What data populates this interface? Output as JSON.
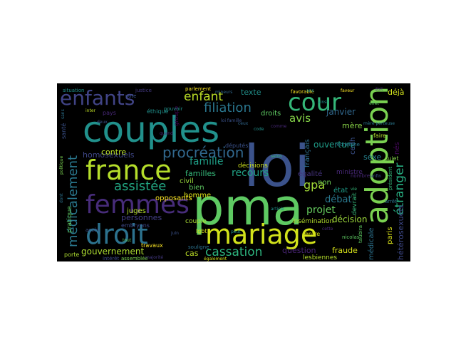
{
  "wordcloud": {
    "background": "#000000",
    "words": [
      {
        "text": "pma",
        "color": "#5ec962"
      },
      {
        "text": "loi",
        "color": "#3b528b"
      },
      {
        "text": "couples",
        "color": "#21918c"
      },
      {
        "text": "adoption",
        "color": "#7ad151"
      },
      {
        "text": "mariage",
        "color": "#d2e21b"
      },
      {
        "text": "droit",
        "color": "#2c728e"
      },
      {
        "text": "france",
        "color": "#b5de2b"
      },
      {
        "text": "femmes",
        "color": "#472c7a"
      },
      {
        "text": "enfants",
        "color": "#414487"
      },
      {
        "text": "cour",
        "color": "#35b779"
      },
      {
        "text": "procréation",
        "color": "#31688e"
      },
      {
        "text": "assistée",
        "color": "#22a884"
      },
      {
        "text": "médicalement",
        "color": "#2a788e"
      },
      {
        "text": "étranger",
        "color": "#27ad81"
      },
      {
        "text": "enfant",
        "color": "#bddf26"
      },
      {
        "text": "filiation",
        "color": "#2a768e"
      },
      {
        "text": "famille",
        "color": "#1fa088"
      },
      {
        "text": "cassation",
        "color": "#2db27d"
      },
      {
        "text": "gpa",
        "color": "#a2da37"
      },
      {
        "text": "avis",
        "color": "#86d549"
      },
      {
        "text": "familles",
        "color": "#35b779"
      },
      {
        "text": "recours",
        "color": "#20a386"
      },
      {
        "text": "homosexuels",
        "color": "#3f4788"
      },
      {
        "text": "gouvernement",
        "color": "#addc30"
      },
      {
        "text": "texte",
        "color": "#21918c"
      },
      {
        "text": "ouverture",
        "color": "#1f9e89"
      },
      {
        "text": "droits",
        "color": "#5ec962"
      },
      {
        "text": "janvier",
        "color": "#31688e"
      },
      {
        "text": "mère",
        "color": "#89d548"
      },
      {
        "text": "contre",
        "color": "#b8de29"
      },
      {
        "text": "civil",
        "color": "#9bd93c"
      },
      {
        "text": "bien",
        "color": "#5ec962"
      },
      {
        "text": "homme",
        "color": "#dde318"
      },
      {
        "text": "juges",
        "color": "#b5de2b"
      },
      {
        "text": "personnes",
        "color": "#433e85"
      },
      {
        "text": "projet",
        "color": "#65cb5e"
      },
      {
        "text": "débat",
        "color": "#2a788e"
      },
      {
        "text": "décision",
        "color": "#9dd93b"
      },
      {
        "text": "égalité",
        "color": "#46337f"
      },
      {
        "text": "français",
        "color": "#2e6f8e"
      },
      {
        "text": "état",
        "color": "#1e9c89"
      },
      {
        "text": "non",
        "color": "#70cf57"
      },
      {
        "text": "question",
        "color": "#482475"
      },
      {
        "text": "fraude",
        "color": "#d8e219"
      },
      {
        "text": "paris",
        "color": "#dae319"
      },
      {
        "text": "hétérosexuels",
        "color": "#3e4989"
      },
      {
        "text": "déjà",
        "color": "#d0e11c"
      },
      {
        "text": "sexe",
        "color": "#26828e"
      },
      {
        "text": "lesbiennes",
        "color": "#b5de2b"
      },
      {
        "text": "députés",
        "color": "#3b528b"
      },
      {
        "text": "opposants",
        "color": "#fde725"
      },
      {
        "text": "décisions",
        "color": "#cde11d"
      },
      {
        "text": "ministre",
        "color": "#482878"
      },
      {
        "text": "cas",
        "color": "#bddf26"
      },
      {
        "text": "insémination",
        "color": "#b2dd2d"
      },
      {
        "text": "devrait",
        "color": "#35b779"
      },
      {
        "text": "nés",
        "color": "#46085c"
      },
      {
        "text": "cedh",
        "color": "#3b528b"
      },
      {
        "text": "médicale",
        "color": "#2c728e"
      },
      {
        "text": "couple",
        "color": "#a8db34"
      },
      {
        "text": "lgbt",
        "color": "#d8e219"
      },
      {
        "text": "embryons",
        "color": "#3e4989"
      },
      {
        "text": "pratique",
        "color": "#5ec962"
      },
      {
        "text": "groupe",
        "color": "#440154"
      },
      {
        "text": "santé",
        "color": "#3b528b"
      },
      {
        "text": "entre",
        "color": "#dde318"
      },
      {
        "text": "travaux",
        "color": "#fde725"
      },
      {
        "text": "sujet",
        "color": "#84d44b"
      },
      {
        "text": "faire",
        "color": "#b5de2b"
      },
      {
        "text": "pays",
        "color": "#482878"
      },
      {
        "text": "intérêt",
        "color": "#3e4989"
      },
      {
        "text": "éthique",
        "color": "#21918c"
      },
      {
        "text": "président",
        "color": "#35b779"
      },
      {
        "text": "nombre",
        "color": "#482878"
      },
      {
        "text": "favorable",
        "color": "#fde725"
      },
      {
        "text": "taubira",
        "color": "#5ec962"
      },
      {
        "text": "arrêt",
        "color": "#2c728e"
      },
      {
        "text": "porte",
        "color": "#addc30"
      },
      {
        "text": "accès",
        "color": "#3b528b"
      },
      {
        "text": "assemblée",
        "color": "#7ad151"
      },
      {
        "text": "souligne",
        "color": "#2c728e"
      },
      {
        "text": "nicolas",
        "color": "#5ec962"
      },
      {
        "text": "recherche",
        "color": "#2a788e"
      },
      {
        "text": "pouvoir",
        "color": "#21918c"
      },
      {
        "text": "vote",
        "color": "#3b528b"
      },
      {
        "text": "situation",
        "color": "#21918c"
      },
      {
        "text": "parlement",
        "color": "#fde725"
      },
      {
        "text": "justice",
        "color": "#443983"
      },
      {
        "text": "inter",
        "color": "#c0df25"
      },
      {
        "text": "deux",
        "color": "#3b528b"
      },
      {
        "text": "mineurs",
        "color": "#31688e"
      },
      {
        "text": "comme",
        "color": "#482878"
      },
      {
        "text": "ans",
        "color": "#21918c"
      },
      {
        "text": "faveur",
        "color": "#fde725"
      },
      {
        "text": "effet",
        "color": "#5ec962"
      },
      {
        "text": "sans",
        "color": "#2c728e"
      },
      {
        "text": "enfin",
        "color": "#3b528b"
      },
      {
        "text": "ainsi",
        "color": "#21918c"
      },
      {
        "text": "selon",
        "color": "#35b779"
      },
      {
        "text": "quand",
        "color": "#482878"
      },
      {
        "text": "mère porteuse",
        "color": "#2a788e"
      },
      {
        "text": "politique",
        "color": "#7ad151"
      },
      {
        "text": "loi famille",
        "color": "#3b528b"
      },
      {
        "text": "également",
        "color": "#d8e219"
      },
      {
        "text": "majorité",
        "color": "#443983"
      },
      {
        "text": "article",
        "color": "#21918c"
      },
      {
        "text": "vie",
        "color": "#35b779"
      },
      {
        "text": "ceux",
        "color": "#31688e"
      },
      {
        "text": "doit",
        "color": "#482878"
      },
      {
        "text": "dont",
        "color": "#2c728e"
      },
      {
        "text": "peut",
        "color": "#21918c"
      },
      {
        "text": "tout",
        "color": "#5ec962"
      },
      {
        "text": "juin",
        "color": "#3b528b"
      },
      {
        "text": "code",
        "color": "#21918c"
      },
      {
        "text": "cette",
        "color": "#482878"
      }
    ]
  }
}
